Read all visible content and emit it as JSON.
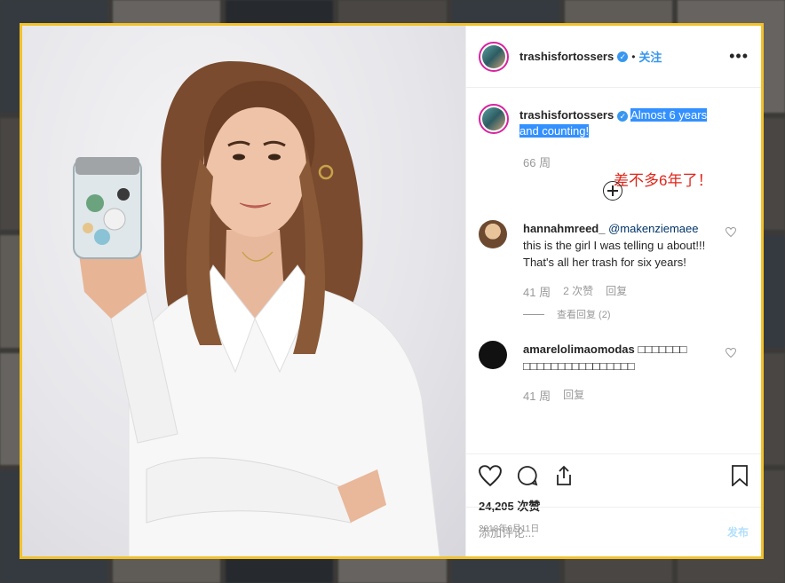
{
  "post": {
    "username": "trashisfortossers",
    "verified_mark": "✓",
    "separator": "•",
    "follow_label": "关注",
    "more_label": "•••"
  },
  "caption": {
    "username": "trashisfortossers",
    "verified_mark": "✓",
    "text_line1": "Almost 6 years",
    "text_line2": "and counting!",
    "age": "66 周",
    "annotation": "差不多6年了！"
  },
  "comments": [
    {
      "username": "hannahmreed_",
      "mention": "@makenziemaee",
      "text": "this is the girl I was telling u about!!! That's all her trash for six years!",
      "age": "41 周",
      "likes": "2 次赞",
      "reply_label": "回复",
      "view_replies": "查看回复 (2)"
    },
    {
      "username": "amarelolimaomodas",
      "text": "□□□□□□□ □□□□□□□□□□□□□□□□",
      "age": "41 周",
      "reply_label": "回复"
    }
  ],
  "stats": {
    "likes": "24,205 次赞",
    "date": "2018年6月11日"
  },
  "compose": {
    "placeholder": "添加评论...",
    "post_label": "发布"
  },
  "icons": {
    "like": "heart-icon",
    "comment": "comment-icon",
    "share": "share-icon",
    "save": "bookmark-icon",
    "add": "plus-circle-icon"
  },
  "colors": {
    "frame": "#f2c22a",
    "highlight": "#3390ff",
    "annotation": "#e0261b",
    "link": "#3897f0"
  }
}
